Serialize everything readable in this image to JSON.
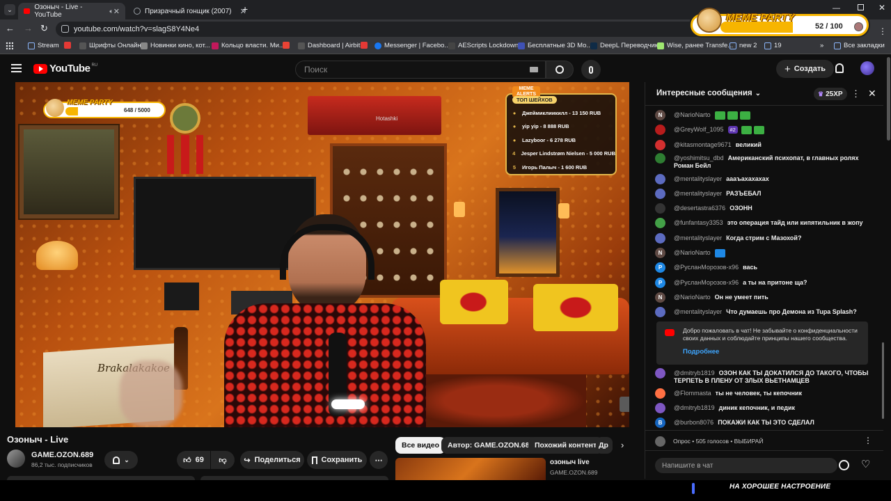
{
  "browser": {
    "tabs": [
      {
        "title": "Озоныч - Live - YouTube",
        "active": true
      },
      {
        "title": "Призрачный гонщик (2007)",
        "active": false
      }
    ],
    "url": "youtube.com/watch?v=slagS8Y4Ne4",
    "bookmarks": [
      {
        "label": "Stream",
        "color": "#8ab4f8"
      },
      {
        "label": "",
        "color": "#e53935"
      },
      {
        "label": "Шрифты Онлайн",
        "color": "#555"
      },
      {
        "label": "Новинки кино, кот...",
        "color": "#888"
      },
      {
        "label": "Кольцо власти. Ми...",
        "color": "#c2185b"
      },
      {
        "label": "",
        "color": "#ea4335"
      },
      {
        "label": "Dashboard | Airbit",
        "color": "#555"
      },
      {
        "label": "",
        "color": "#e53935"
      },
      {
        "label": "Messenger | Facebo...",
        "color": "#1877f2"
      },
      {
        "label": "AEScripts Lockdown...",
        "color": "#444"
      },
      {
        "label": "Бесплатные 3D Мо...",
        "color": "#3f51b5"
      },
      {
        "label": "DeepL Переводчик",
        "color": "#0f2b46"
      },
      {
        "label": "Wise, ранее Transfe...",
        "color": "#9fe870"
      },
      {
        "label": "new 2",
        "color": "#8ab4f8"
      },
      {
        "label": "19",
        "color": "#8ab4f8"
      },
      {
        "label": "Все закладки",
        "color": "#8ab4f8"
      }
    ]
  },
  "overlay_top": {
    "brand": "MEME PARTY",
    "count": "52 / 100"
  },
  "youtube": {
    "logo": "YouTube",
    "region": "RU",
    "search_placeholder": "Поиск",
    "create_label": "Создать"
  },
  "stream_overlay": {
    "party_brand": "MEME PARTY",
    "party_count": "648 / 5000",
    "alerts_brand": "MEME ALERTS",
    "top_title": "ТОП ШЕЙХОВ",
    "top_donors": [
      {
        "rank": "",
        "text": "Джеймиклиикилл - 13 150 RUB"
      },
      {
        "rank": "",
        "text": "yip yip - 8 888 RUB"
      },
      {
        "rank": "",
        "text": "Lazyboor - 6 278 RUB"
      },
      {
        "rank": "4",
        "text": "Jesper Lindstrøm Nielsen - 5 000 RUB"
      },
      {
        "rank": "5",
        "text": "Игорь Палыч - 1 600 RUB"
      }
    ],
    "ac_brand": "Hotashki",
    "box_text": "Brakalakakoe"
  },
  "video_info": {
    "title": "Озоныч - Live",
    "channel": "GAME.OZON.689",
    "subscribers": "86,2 тыс. подписчиков",
    "likes": "69",
    "share_label": "Поделиться",
    "save_label": "Сохранить"
  },
  "chips": [
    "Все видео",
    "Автор: GAME.OZON.689",
    "Похожий контент",
    "Др"
  ],
  "related": {
    "title": "озоныч live",
    "channel": "GAME.OZON.689"
  },
  "chat": {
    "header": "Интересные сообщения",
    "xp_badge": "25XP",
    "messages": [
      {
        "author": "@NarioNarto",
        "text": "",
        "avatar_letter": "N",
        "avatar_color": "#5f4a44",
        "emotes": [
          "#3cb043",
          "#3cb043",
          "#3cb043"
        ],
        "badge": ""
      },
      {
        "author": "@GreyWolf_1095",
        "text": "",
        "avatar_letter": "",
        "avatar_color": "#b71c1c",
        "emotes": [
          "#3cb043",
          "#3cb043"
        ],
        "badge": "#2"
      },
      {
        "author": "@kitasmontage9671",
        "text": "великий",
        "avatar_letter": "",
        "avatar_color": "#d32f2f",
        "emotes": [],
        "badge": ""
      },
      {
        "author": "@yoshimitsu_dbd",
        "text": "Американский психопат, в главных ролях Роман Бейл",
        "avatar_letter": "",
        "avatar_color": "#2e7d32",
        "emotes": [],
        "badge": ""
      },
      {
        "author": "@mentalityslayer",
        "text": "аааъахахахах",
        "avatar_letter": "",
        "avatar_color": "#5c6bc0",
        "emotes": [],
        "badge": ""
      },
      {
        "author": "@mentalityslayer",
        "text": "РАЗЪЕБАЛ",
        "avatar_letter": "",
        "avatar_color": "#5c6bc0",
        "emotes": [],
        "badge": ""
      },
      {
        "author": "@desertastra6376",
        "text": "ОЗОНН",
        "avatar_letter": "",
        "avatar_color": "#333",
        "emotes": [],
        "badge": ""
      },
      {
        "author": "@funfantasy3353",
        "text": "это операция тайд или кипятильник в жопу",
        "avatar_letter": "",
        "avatar_color": "#43a047",
        "emotes": [],
        "badge": ""
      },
      {
        "author": "@mentalityslayer",
        "text": "Когда стрим с Мазохой?",
        "avatar_letter": "",
        "avatar_color": "#5c6bc0",
        "emotes": [],
        "badge": ""
      },
      {
        "author": "@NarioNarto",
        "text": "",
        "avatar_letter": "N",
        "avatar_color": "#5f4a44",
        "emotes": [
          "#1e88e5"
        ],
        "badge": ""
      },
      {
        "author": "@РусланМорозов-х96",
        "text": "вась",
        "avatar_letter": "P",
        "avatar_color": "#1e88e5",
        "emotes": [],
        "badge": ""
      },
      {
        "author": "@РусланМорозов-х96",
        "text": "а ты на притоне ща?",
        "avatar_letter": "P",
        "avatar_color": "#1e88e5",
        "emotes": [],
        "badge": ""
      },
      {
        "author": "@NarioNarto",
        "text": "Он не умеет пить",
        "avatar_letter": "N",
        "avatar_color": "#5f4a44",
        "emotes": [],
        "badge": ""
      },
      {
        "author": "@mentalityslayer",
        "text": "Что думаешь про Демона из Tupa Splash?",
        "avatar_letter": "",
        "avatar_color": "#5c6bc0",
        "emotes": [],
        "badge": ""
      }
    ],
    "notice_text": "Добро пожаловать в чат! Не забывайте о конфиденциальности своих данных и соблюдайте принципы нашего сообщества.",
    "notice_link": "Подробнее",
    "messages_after": [
      {
        "author": "@dmitryb1819",
        "text": "ОЗОН КАК ТЫ ДОКАТИЛСЯ ДО ТАКОГО, ЧТОБЫ ТЕРПЕТЬ В ПЛЕНУ ОТ ЗЛЫХ ВЬЕТНАМЦЕВ",
        "avatar_letter": "",
        "avatar_color": "#7e57c2"
      },
      {
        "author": "@Flommasta",
        "text": "ты не человек, ты кепочник",
        "avatar_letter": "",
        "avatar_color": "#ff7043"
      },
      {
        "author": "@dmitryb1819",
        "text": "диник кепочник, и педик",
        "avatar_letter": "",
        "avatar_color": "#7e57c2"
      },
      {
        "author": "@burbon8076",
        "text": "ПОКАЖИ КАК ТЫ ЭТО СДЕЛАЛ",
        "avatar_letter": "B",
        "avatar_color": "#1565c0"
      }
    ],
    "poll_text": "Опрос • 505 голосов • ВЫБИРАЙ",
    "input_placeholder": "Напишите в чат"
  },
  "bottom_overlay": "НА ХОРОШЕЕ НАСТРОЕНИЕ"
}
